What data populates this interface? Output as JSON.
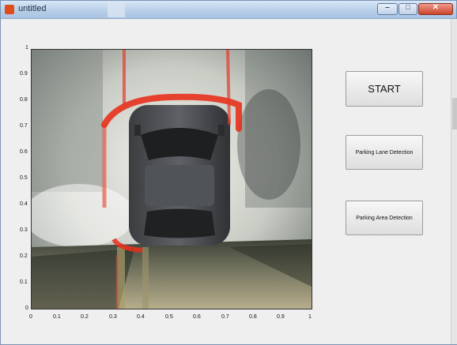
{
  "window": {
    "title": "untitled"
  },
  "buttons": {
    "start": "START",
    "lane_detection": "Parking Lane Detection",
    "area_detection": "Parking Area Detection"
  },
  "axes": {
    "y_ticks": [
      "0",
      "0.1",
      "0.2",
      "0.3",
      "0.4",
      "0.5",
      "0.6",
      "0.7",
      "0.8",
      "0.9",
      "1"
    ],
    "x_ticks": [
      "0",
      "0.1",
      "0.2",
      "0.3",
      "0.4",
      "0.5",
      "0.6",
      "0.7",
      "0.8",
      "0.9",
      "1"
    ]
  },
  "colors": {
    "window_bg": "#efefef",
    "detection_overlay": "#e8311c"
  }
}
